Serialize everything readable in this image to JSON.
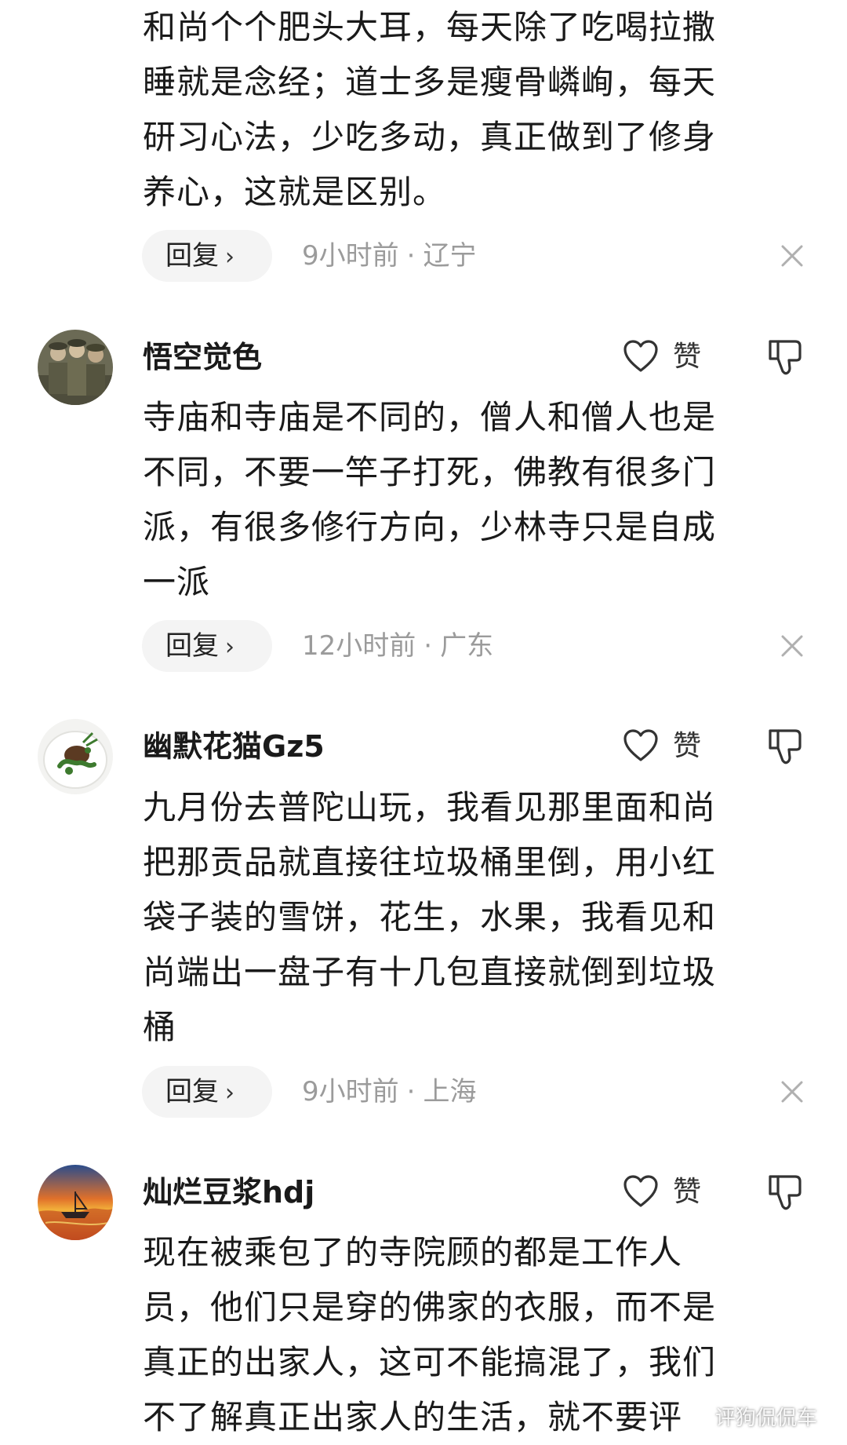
{
  "comments": [
    {
      "lines": [
        "和尚个个肥头大耳，每天除了吃喝拉撒",
        "睡就是念经；道士多是瘦骨嶙峋，每天",
        "研习心法，少吃多动，真正做到了修身",
        "养心，这就是区别。"
      ],
      "reply_label": "回复",
      "time": "9小时前",
      "location": "辽宁"
    },
    {
      "username": "悟空觉色",
      "like_label": "赞",
      "lines": [
        "寺庙和寺庙是不同的，僧人和僧人也是",
        "不同，不要一竿子打死，佛教有很多门",
        "派，有很多修行方向，少林寺只是自成",
        "一派"
      ],
      "reply_label": "回复",
      "time": "12小时前",
      "location": "广东"
    },
    {
      "username": "幽默花猫Gz5",
      "like_label": "赞",
      "lines": [
        "九月份去普陀山玩，我看见那里面和尚",
        "把那贡品就直接往垃圾桶里倒，用小红",
        "袋子装的雪饼，花生，水果，我看见和",
        "尚端出一盘子有十几包直接就倒到垃圾",
        "桶"
      ],
      "reply_label": "回复",
      "time": "9小时前",
      "location": "上海"
    },
    {
      "username": "灿烂豆浆hdj",
      "like_label": "赞",
      "lines": [
        "现在被乘包了的寺院顾的都是工作人",
        "员，他们只是穿的佛家的衣服，而不是",
        "真正的出家人，这可不能搞混了，我们",
        "不了解真正出家人的生活，就不要评"
      ]
    }
  ],
  "icons": {
    "like": "heart-outline-icon",
    "dislike": "thumbs-down-icon",
    "close": "close-icon",
    "reply_chevron": "chevron-right-icon"
  },
  "watermark": "评狗侃侃车",
  "colors": {
    "text": "#1a1a1a",
    "meta": "#9b9b9b",
    "pill_bg": "#f4f4f4",
    "icon": "#333333"
  }
}
